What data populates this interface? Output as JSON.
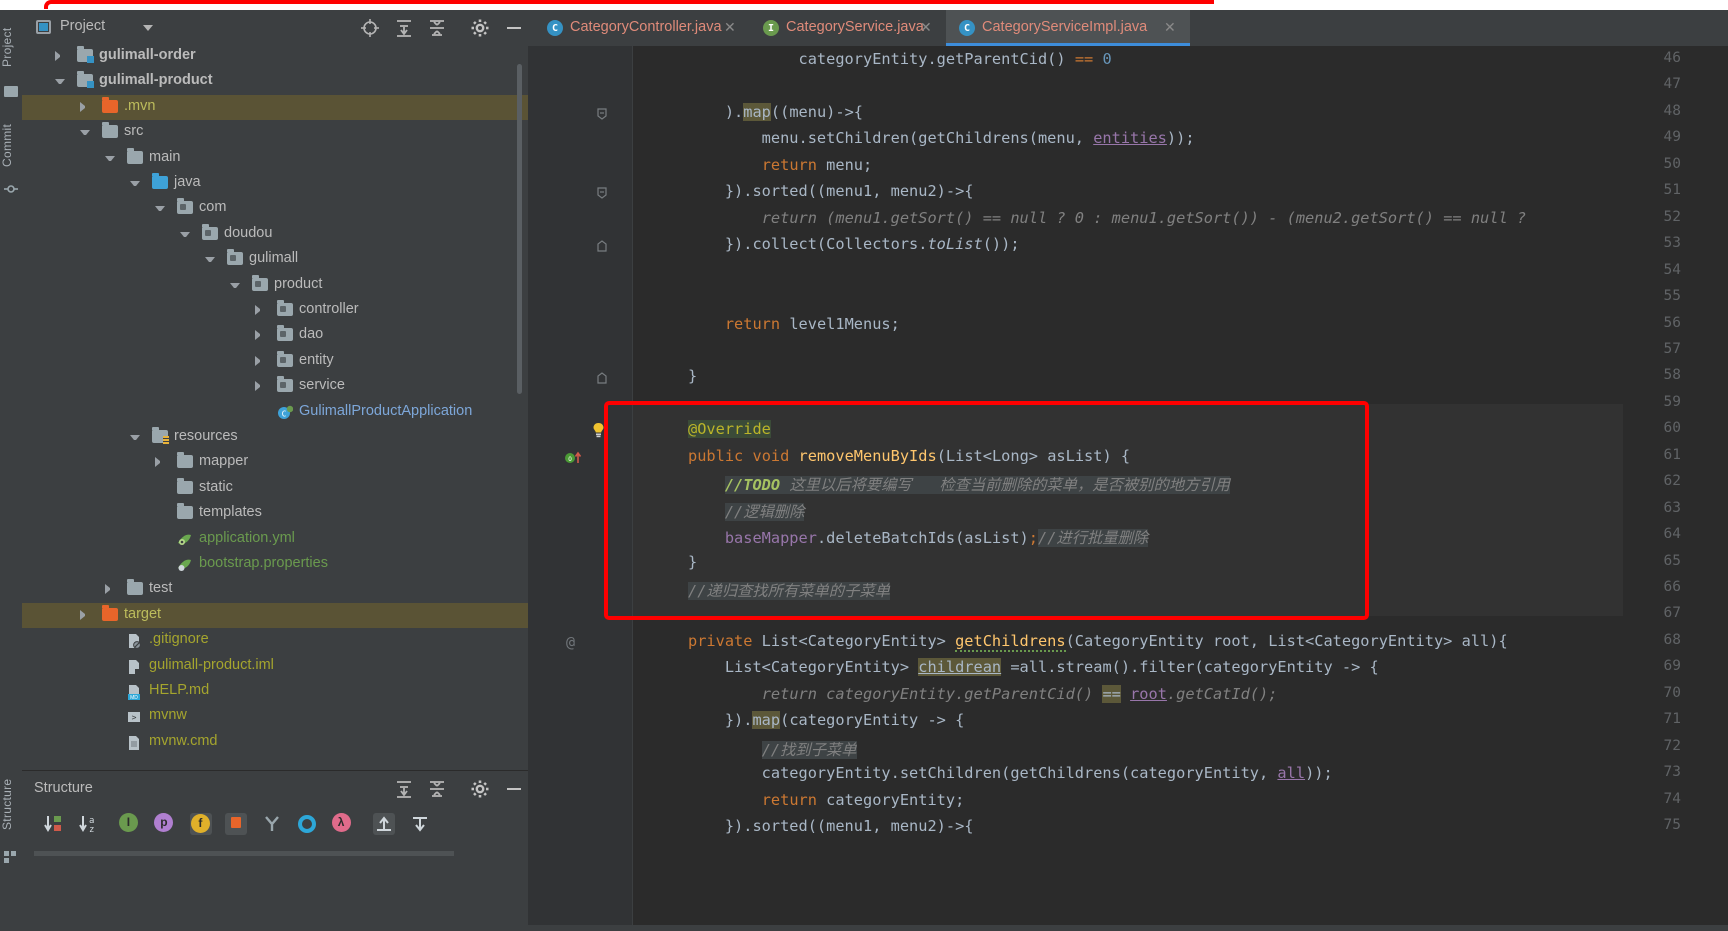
{
  "app": {
    "theme_bg": "#3c3f41",
    "editor_bg": "#2b2b2b",
    "accent": "#3d8ddb",
    "annotation_color": "#fe0000"
  },
  "left_rail": {
    "items": [
      {
        "label": "Project",
        "icon": "project-icon"
      },
      {
        "label": "Commit",
        "icon": "commit-icon"
      },
      {
        "label": "Structure",
        "icon": "structure-icon"
      }
    ]
  },
  "project_panel": {
    "title": "Project",
    "dropdown_icon": "chevron-down-icon",
    "toolbar": [
      {
        "name": "locate-icon",
        "glyph": "target"
      },
      {
        "name": "expand-all-icon",
        "glyph": "expand"
      },
      {
        "name": "collapse-all-icon",
        "glyph": "collapse"
      },
      {
        "name": "settings-gear-icon",
        "glyph": "gear"
      },
      {
        "name": "hide-panel-icon",
        "glyph": "minus"
      }
    ],
    "tree": [
      {
        "label": "gulimall-order",
        "indent": 1,
        "arrow": "right",
        "icon": "module-folder",
        "style": "bold",
        "selected": false
      },
      {
        "label": "gulimall-product",
        "indent": 1,
        "arrow": "down",
        "icon": "module-folder",
        "style": "bold",
        "selected": false
      },
      {
        "label": ".mvn",
        "indent": 2,
        "arrow": "right",
        "icon": "excluded-folder",
        "style": "yellow",
        "selected": true
      },
      {
        "label": "src",
        "indent": 2,
        "arrow": "down",
        "icon": "gray-folder",
        "style": "normal",
        "selected": false
      },
      {
        "label": "main",
        "indent": 3,
        "arrow": "down",
        "icon": "gray-folder",
        "style": "normal",
        "selected": false
      },
      {
        "label": "java",
        "indent": 4,
        "arrow": "down",
        "icon": "source-folder",
        "style": "normal",
        "selected": false
      },
      {
        "label": "com",
        "indent": 5,
        "arrow": "down",
        "icon": "package-folder",
        "style": "normal",
        "selected": false
      },
      {
        "label": "doudou",
        "indent": 6,
        "arrow": "down",
        "icon": "package-folder",
        "style": "normal",
        "selected": false
      },
      {
        "label": "gulimall",
        "indent": 7,
        "arrow": "down",
        "icon": "package-folder",
        "style": "normal",
        "selected": false
      },
      {
        "label": "product",
        "indent": 8,
        "arrow": "down",
        "icon": "package-folder",
        "style": "normal",
        "selected": false
      },
      {
        "label": "controller",
        "indent": 9,
        "arrow": "right",
        "icon": "package-folder",
        "style": "normal",
        "selected": false
      },
      {
        "label": "dao",
        "indent": 9,
        "arrow": "right",
        "icon": "package-folder",
        "style": "normal",
        "selected": false
      },
      {
        "label": "entity",
        "indent": 9,
        "arrow": "right",
        "icon": "package-folder",
        "style": "normal",
        "selected": false
      },
      {
        "label": "service",
        "indent": 9,
        "arrow": "right",
        "icon": "package-folder",
        "style": "normal",
        "selected": false
      },
      {
        "label": "GulimallProductApplication",
        "indent": 9,
        "arrow": "none",
        "icon": "spring-class-icon",
        "style": "blue",
        "selected": false
      },
      {
        "label": "resources",
        "indent": 4,
        "arrow": "down",
        "icon": "resources-folder",
        "style": "normal",
        "selected": false
      },
      {
        "label": "mapper",
        "indent": 5,
        "arrow": "right",
        "icon": "gray-folder",
        "style": "normal",
        "selected": false
      },
      {
        "label": "static",
        "indent": 5,
        "arrow": "none",
        "icon": "gray-folder",
        "style": "normal",
        "selected": false
      },
      {
        "label": "templates",
        "indent": 5,
        "arrow": "none",
        "icon": "gray-folder",
        "style": "normal",
        "selected": false
      },
      {
        "label": "application.yml",
        "indent": 5,
        "arrow": "none",
        "icon": "spring-yaml-icon",
        "style": "green",
        "selected": false
      },
      {
        "label": "bootstrap.properties",
        "indent": 5,
        "arrow": "none",
        "icon": "spring-props-icon",
        "style": "green",
        "selected": false
      },
      {
        "label": "test",
        "indent": 3,
        "arrow": "right",
        "icon": "gray-folder",
        "style": "normal",
        "selected": false
      },
      {
        "label": "target",
        "indent": 2,
        "arrow": "right",
        "icon": "excluded-folder",
        "style": "yellow",
        "selected": true
      },
      {
        "label": ".gitignore",
        "indent": 3,
        "arrow": "none",
        "icon": "gitignore-file-icon",
        "style": "olive",
        "selected": false
      },
      {
        "label": "gulimall-product.iml",
        "indent": 3,
        "arrow": "none",
        "icon": "iml-file-icon",
        "style": "olive",
        "selected": false
      },
      {
        "label": "HELP.md",
        "indent": 3,
        "arrow": "none",
        "icon": "markdown-file-icon",
        "style": "olive",
        "selected": false
      },
      {
        "label": "mvnw",
        "indent": 3,
        "arrow": "none",
        "icon": "shell-file-icon",
        "style": "olive",
        "selected": false
      },
      {
        "label": "mvnw.cmd",
        "indent": 3,
        "arrow": "none",
        "icon": "text-file-icon",
        "style": "olive",
        "selected": false
      }
    ]
  },
  "structure_panel": {
    "title": "Structure",
    "header_tools": [
      {
        "name": "expand-all-icon"
      },
      {
        "name": "collapse-all-icon"
      },
      {
        "name": "settings-gear-icon"
      },
      {
        "name": "hide-panel-icon"
      }
    ],
    "toolbar": [
      {
        "name": "sort-by-visibility-icon",
        "color": "#cfd6db"
      },
      {
        "name": "sort-alphabetically-icon",
        "color": "#cfd6db"
      },
      {
        "name": "show-inherited-icon",
        "color": "#6a9a4e",
        "glyph": "I"
      },
      {
        "name": "show-properties-icon",
        "color": "#b07fd0",
        "glyph": "p"
      },
      {
        "name": "show-fields-icon",
        "color": "#e0b02a",
        "glyph": "f",
        "active": true
      },
      {
        "name": "show-non-public-icon",
        "color": "#e8652a",
        "glyph": "lock",
        "active": true
      },
      {
        "name": "show-anonymous-classes-icon",
        "color": "#9aa7ad",
        "glyph": "Y"
      },
      {
        "name": "show-interfaces-icon",
        "color": "#2da7d8",
        "glyph": "O"
      },
      {
        "name": "show-lambdas-icon",
        "color": "#e06b8b",
        "glyph": "λ"
      },
      {
        "name": "expand-tree-icon",
        "color": "#cfd6db",
        "active": true
      },
      {
        "name": "collapse-tree-icon",
        "color": "#cfd6db"
      }
    ]
  },
  "editor": {
    "tabs": [
      {
        "label": "CategoryController.java",
        "icon": "java-class-icon",
        "icon_color": "#3592c4",
        "icon_glyph": "C",
        "active": false,
        "closable": true
      },
      {
        "label": "CategoryService.java",
        "icon": "java-interface-icon",
        "icon_color": "#6a9a4e",
        "icon_glyph": "I",
        "active": false,
        "closable": true
      },
      {
        "label": "CategoryServiceImpl.java",
        "icon": "java-class-icon",
        "icon_color": "#3592c4",
        "icon_glyph": "C",
        "active": true,
        "closable": true
      }
    ],
    "first_line_number": 46,
    "last_line_number": 75,
    "lines": [
      {
        "n": 46,
        "text": "            categoryEntity.getParentCid() == 0"
      },
      {
        "n": 47,
        "text": ""
      },
      {
        "n": 48,
        "text": "    ).map((menu)->{",
        "fold": "open"
      },
      {
        "n": 49,
        "text": "        menu.setChildren(getChildrens(menu, entities));"
      },
      {
        "n": 50,
        "text": "        return menu;"
      },
      {
        "n": 51,
        "text": "    }).sorted((menu1, menu2)->{",
        "fold": "open"
      },
      {
        "n": 52,
        "text": "        return (menu1.getSort() == null ? 0 : menu1.getSort()) - (menu2.getSort() == null ?"
      },
      {
        "n": 53,
        "text": "    }).collect(Collectors.toList());",
        "fold": "close"
      },
      {
        "n": 54,
        "text": ""
      },
      {
        "n": 55,
        "text": ""
      },
      {
        "n": 56,
        "text": "    return level1Menus;"
      },
      {
        "n": 57,
        "text": ""
      },
      {
        "n": 58,
        "text": "}",
        "fold": "close"
      },
      {
        "n": 59,
        "text": ""
      },
      {
        "n": 60,
        "text": "@Override",
        "gutter": "lightbulb"
      },
      {
        "n": 61,
        "text": "public void removeMenuByIds(List<Long> asList) {",
        "gutter": "implementing-method"
      },
      {
        "n": 62,
        "text": "    //TODO 这里以后将要编写   检查当前删除的菜单，是否被别的地方引用"
      },
      {
        "n": 63,
        "text": "    //逻辑删除"
      },
      {
        "n": 64,
        "text": "    baseMapper.deleteBatchIds(asList);//进行批量删除"
      },
      {
        "n": 65,
        "text": "}"
      },
      {
        "n": 66,
        "text": "//递归查找所有菜单的子菜单"
      },
      {
        "n": 67,
        "text": ""
      },
      {
        "n": 68,
        "text": "private List<CategoryEntity> getChildrens(CategoryEntity root, List<CategoryEntity> all){",
        "gutter": "at-sign"
      },
      {
        "n": 69,
        "text": "    List<CategoryEntity> childrean =all.stream().filter(categoryEntity -> {"
      },
      {
        "n": 70,
        "text": "        return categoryEntity.getParentCid() == root.getCatId();"
      },
      {
        "n": 71,
        "text": "    }).map(categoryEntity -> {"
      },
      {
        "n": 72,
        "text": "        //找到子菜单"
      },
      {
        "n": 73,
        "text": "        categoryEntity.setChildren(getChildrens(categoryEntity, all));"
      },
      {
        "n": 74,
        "text": "        return categoryEntity;"
      },
      {
        "n": 75,
        "text": "    }).sorted((menu1, menu2)->{"
      }
    ],
    "annotation": {
      "shape": "rectangle",
      "color": "#fe0000",
      "covers_lines": "59-67",
      "description": "red highlight box around removeMenuByIds method"
    }
  }
}
